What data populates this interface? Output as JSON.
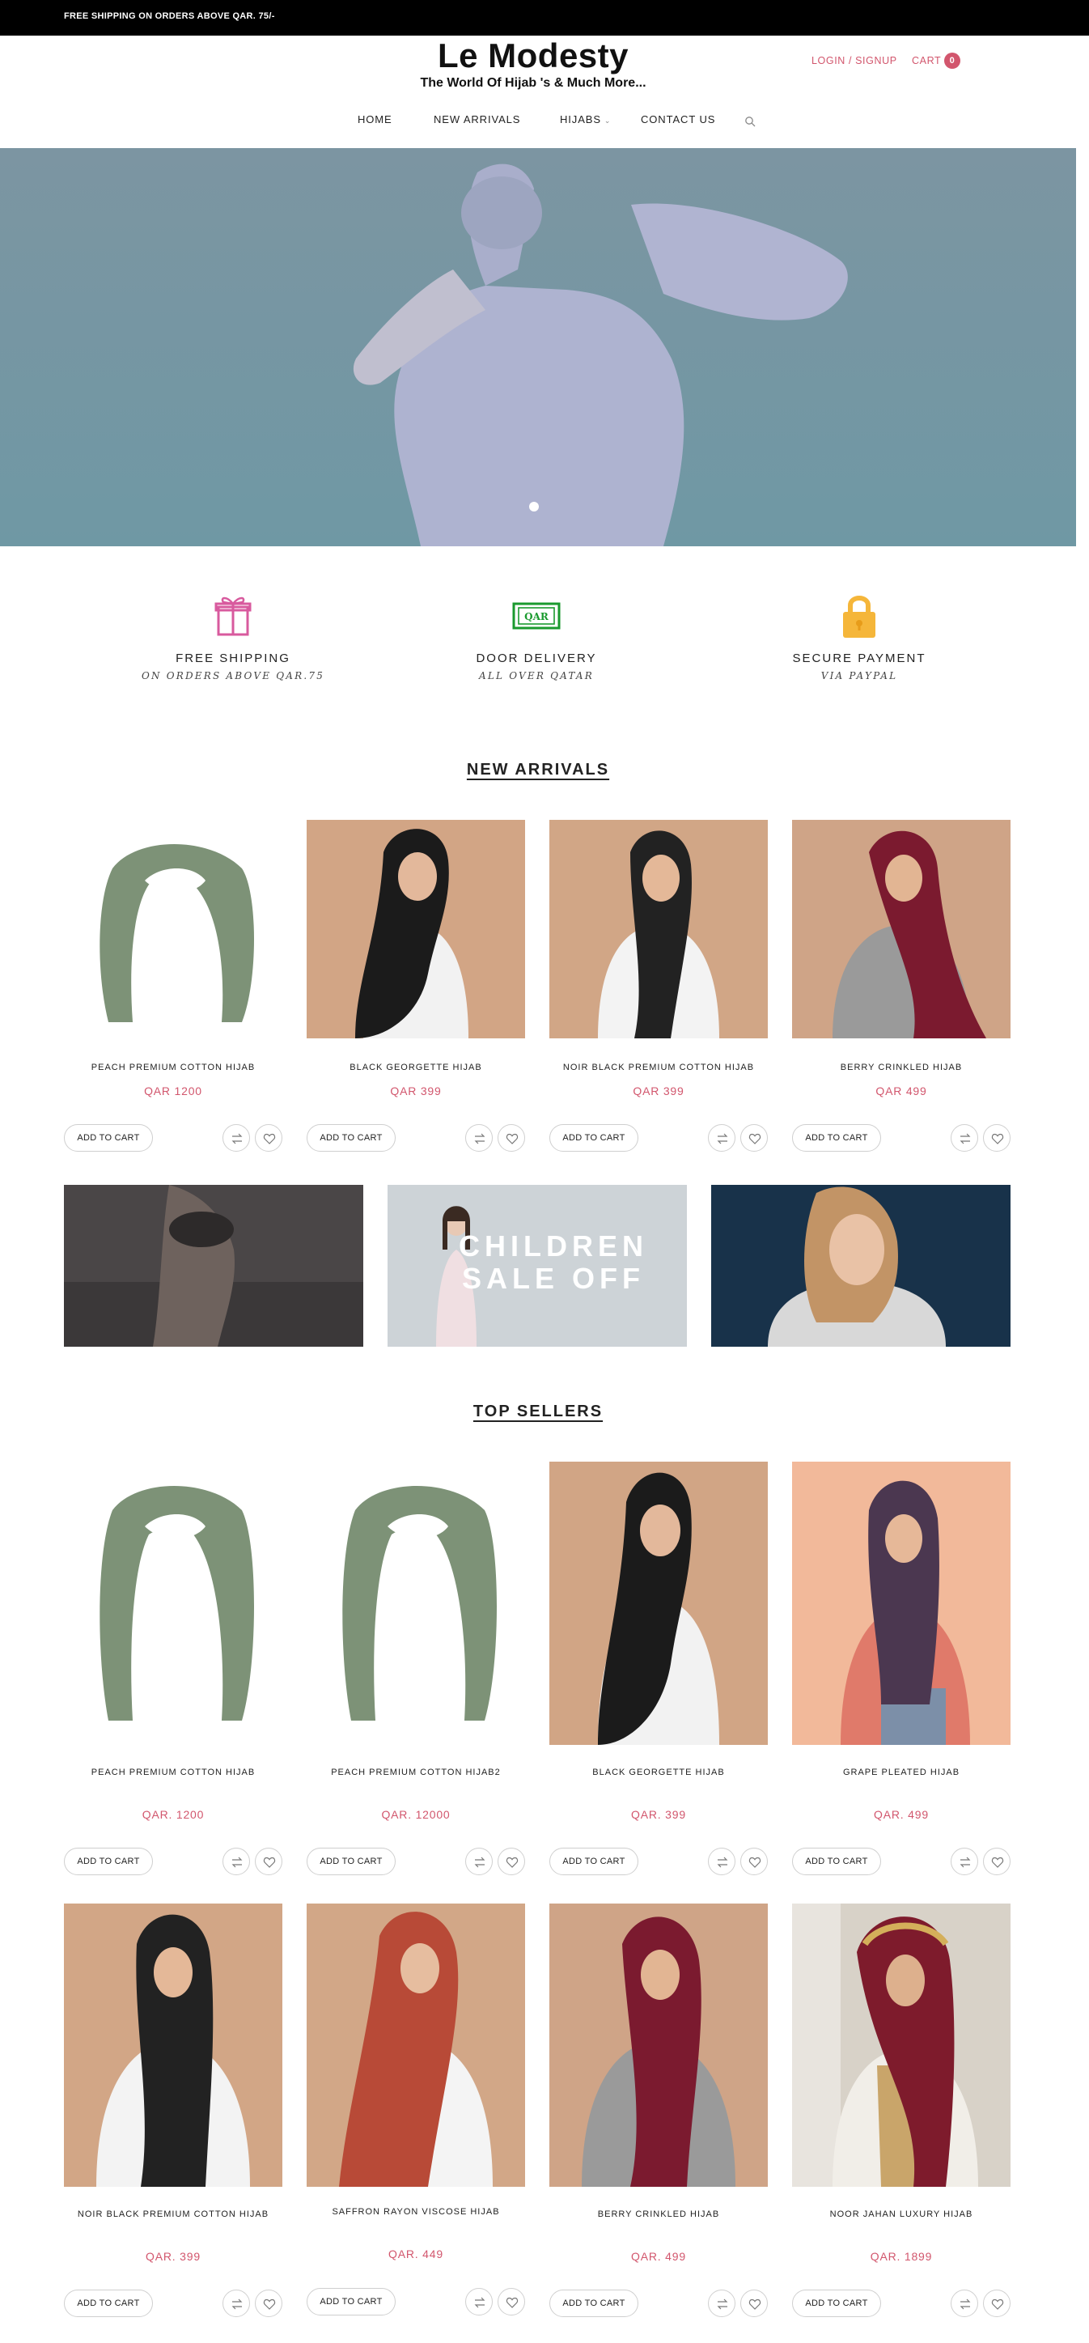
{
  "topbar": {
    "text": "FREE SHIPPING ON ORDERS ABOVE QAR. 75/-"
  },
  "brand": {
    "title": "Le Modesty",
    "tagline": "The World Of Hijab 's & Much More..."
  },
  "account": {
    "login_label": "LOGIN / SIGNUP",
    "cart_label": "CART",
    "cart_count": "0"
  },
  "nav": {
    "items": [
      "HOME",
      "NEW ARRIVALS",
      "HIJABS",
      "CONTACT US"
    ]
  },
  "features": [
    {
      "title": "FREE SHIPPING",
      "subtitle": "ON ORDERS ABOVE QAR.75",
      "icon": "gift-icon"
    },
    {
      "title": "DOOR DELIVERY",
      "subtitle": "ALL OVER QATAR",
      "icon": "qar-banknote-icon",
      "icon_text": "QAR"
    },
    {
      "title": "SECURE PAYMENT",
      "subtitle": "VIA PAYPAL",
      "icon": "padlock-icon"
    }
  ],
  "new_arrivals": {
    "title": "NEW ARRIVALS",
    "products": [
      {
        "name": "PEACH PREMIUM COTTON HIJAB",
        "price": "QAR 1200",
        "add_label": "ADD TO CART"
      },
      {
        "name": "BLACK GEORGETTE HIJAB",
        "price": "QAR 399",
        "add_label": "ADD TO CART"
      },
      {
        "name": "NOIR BLACK PREMIUM COTTON HIJAB",
        "price": "QAR 399",
        "add_label": "ADD TO CART"
      },
      {
        "name": "BERRY CRINKLED HIJAB",
        "price": "QAR 499",
        "add_label": "ADD TO CART"
      }
    ]
  },
  "banners": [
    {
      "text": ""
    },
    {
      "text": "CHILDREN SALE OFF"
    },
    {
      "text": ""
    }
  ],
  "top_sellers": {
    "title": "TOP SELLERS",
    "products": [
      {
        "name": "PEACH PREMIUM COTTON HIJAB",
        "price": "QAR. 1200",
        "add_label": "ADD TO CART"
      },
      {
        "name": "PEACH PREMIUM COTTON HIJAB2",
        "price": "QAR. 12000",
        "add_label": "ADD TO CART"
      },
      {
        "name": "BLACK GEORGETTE HIJAB",
        "price": "QAR. 399",
        "add_label": "ADD TO CART"
      },
      {
        "name": "GRAPE PLEATED HIJAB",
        "price": "QAR. 499",
        "add_label": "ADD TO CART"
      },
      {
        "name": "NOIR BLACK PREMIUM COTTON HIJAB",
        "price": "QAR. 399",
        "add_label": "ADD TO CART"
      },
      {
        "name": "SAFFRON RAYON VISCOSE HIJAB",
        "price": "QAR. 449",
        "add_label": "ADD TO CART"
      },
      {
        "name": "BERRY CRINKLED HIJAB",
        "price": "QAR. 499",
        "add_label": "ADD TO CART"
      },
      {
        "name": "NOOR JAHAN LUXURY HIJAB",
        "price": "QAR. 1899",
        "add_label": "ADD TO CART"
      }
    ]
  },
  "colors": {
    "accent": "#d2566d",
    "topbar": "#000000",
    "hero": "#8199a6"
  }
}
